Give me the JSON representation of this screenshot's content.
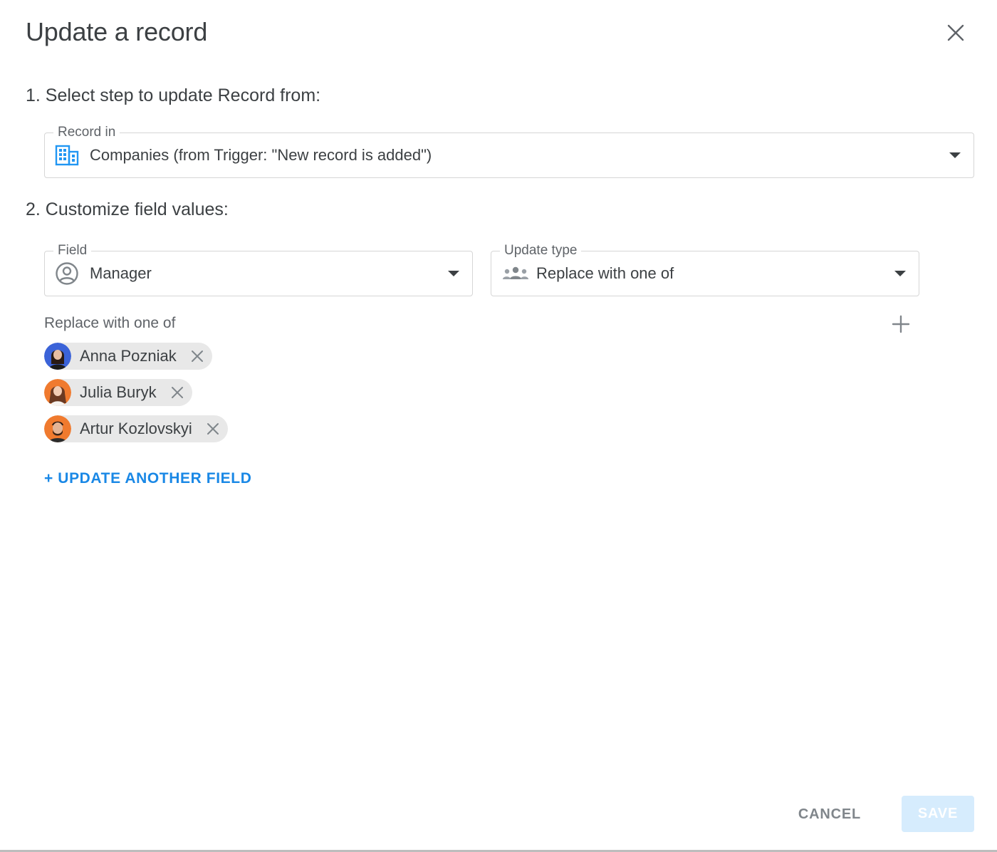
{
  "dialog": {
    "title": "Update a record",
    "close_icon": "close-icon"
  },
  "step1": {
    "heading": "1. Select step to update Record from:",
    "record_select": {
      "label": "Record in",
      "value": "Companies (from Trigger: \"New record is added\")",
      "icon": "building-icon"
    }
  },
  "step2": {
    "heading": "2. Customize field values:",
    "field_select": {
      "label": "Field",
      "value": "Manager",
      "icon": "user-circle-icon"
    },
    "update_type_select": {
      "label": "Update type",
      "value": "Replace with one of",
      "icon": "group-icon"
    },
    "values_label": "Replace with one of",
    "values": [
      {
        "name": "Anna Pozniak"
      },
      {
        "name": "Julia Buryk"
      },
      {
        "name": "Artur Kozlovskyi"
      }
    ],
    "update_another_label": "+ UPDATE ANOTHER FIELD"
  },
  "footer": {
    "cancel_label": "CANCEL",
    "save_label": "SAVE"
  },
  "colors": {
    "accent": "#1a88e6",
    "save_disabled_bg": "#d6ecfd",
    "chip_bg": "#e8e8e8",
    "border": "#d6d6d6"
  }
}
